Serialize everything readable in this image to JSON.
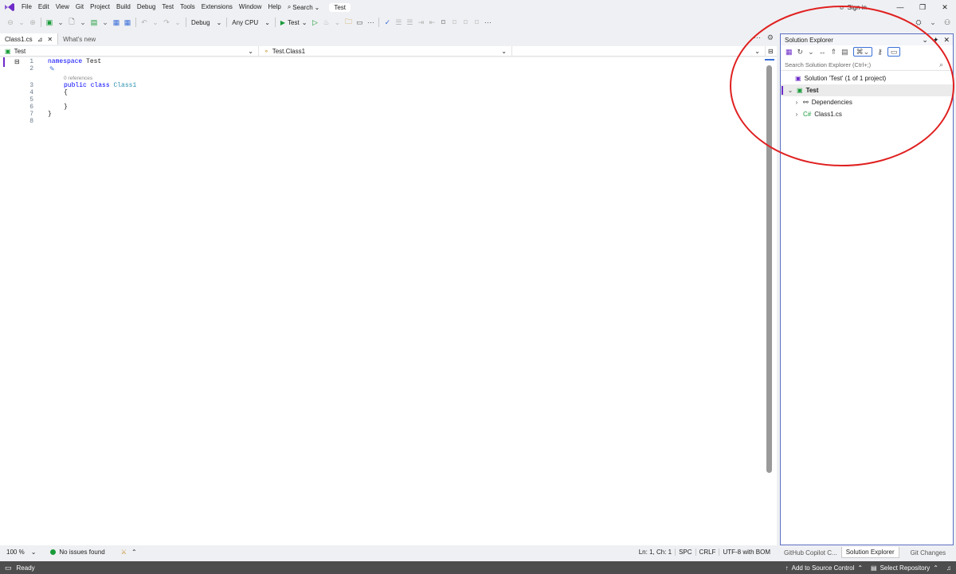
{
  "menubar": {
    "items": [
      "File",
      "Edit",
      "View",
      "Git",
      "Project",
      "Build",
      "Debug",
      "Test",
      "Tools",
      "Extensions",
      "Window",
      "Help"
    ],
    "search_label": "Search",
    "solution_name": "Test",
    "sign_in": "Sign in"
  },
  "toolbar": {
    "config": "Debug",
    "platform": "Any CPU",
    "run_target": "Test"
  },
  "doc_tabs": {
    "active": "Class1.cs",
    "other": "What's new"
  },
  "navbar": {
    "project": "Test",
    "type": "Test.Class1",
    "member": ""
  },
  "editor": {
    "line_numbers": [
      "1",
      "2",
      "3",
      "4",
      "5",
      "6",
      "7",
      "8"
    ],
    "codelens": "0 references",
    "line1_kw": "namespace",
    "line1_name": "Test",
    "line3_kw1": "public",
    "line3_kw2": "class",
    "line3_name": "Class1",
    "open_brace": "{",
    "close_brace": "}"
  },
  "editor_status": {
    "zoom": "100 %",
    "issues": "No issues found",
    "position": "Ln: 1, Ch: 1",
    "whitespace": "SPC",
    "line_ending": "CRLF",
    "encoding": "UTF-8 with BOM"
  },
  "solution_explorer": {
    "title": "Solution Explorer",
    "search_placeholder": "Search Solution Explorer (Ctrl+;)",
    "solution_node": "Solution 'Test' (1 of 1 project)",
    "project_node": "Test",
    "dependencies_node": "Dependencies",
    "file_node": "Class1.cs"
  },
  "panel_tabs": [
    "GitHub Copilot C...",
    "Solution Explorer",
    "Git Changes"
  ],
  "statusbar": {
    "ready": "Ready",
    "add_source_control": "Add to Source Control",
    "select_repository": "Select Repository"
  },
  "colors": {
    "accent": "#6d2ac8",
    "keyword": "#0000ff",
    "type": "#2b91af",
    "annotation": "#e02020",
    "statusbar": "#4d4d4d"
  }
}
